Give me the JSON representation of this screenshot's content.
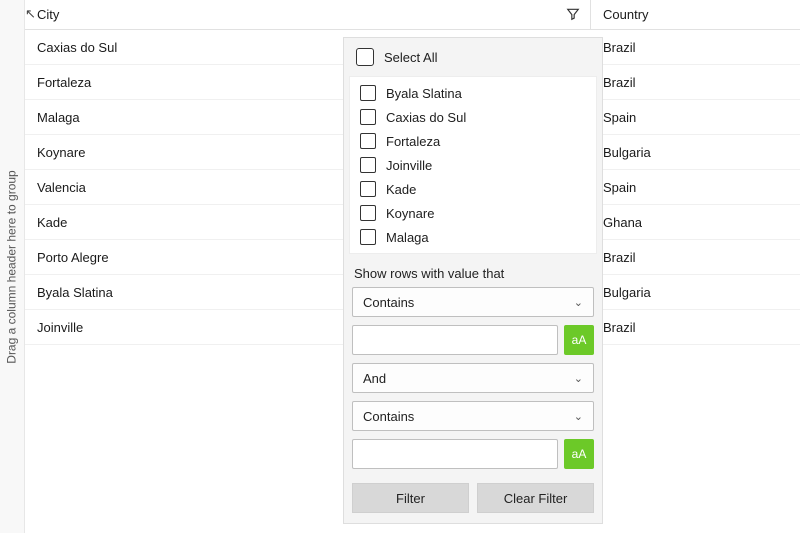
{
  "groupbar_text": "Drag a column header here to group",
  "columns": {
    "city": "City",
    "country": "Country"
  },
  "rows": [
    {
      "city": "Caxias do Sul",
      "country": "Brazil"
    },
    {
      "city": "Fortaleza",
      "country": "Brazil"
    },
    {
      "city": "Malaga",
      "country": "Spain"
    },
    {
      "city": "Koynare",
      "country": "Bulgaria"
    },
    {
      "city": "Valencia",
      "country": "Spain"
    },
    {
      "city": "Kade",
      "country": "Ghana"
    },
    {
      "city": "Porto Alegre",
      "country": "Brazil"
    },
    {
      "city": "Byala Slatina",
      "country": "Bulgaria"
    },
    {
      "city": "Joinville",
      "country": "Brazil"
    }
  ],
  "filter_popup": {
    "select_all_label": "Select All",
    "options": [
      "Byala Slatina",
      "Caxias do Sul",
      "Fortaleza",
      "Joinville",
      "Kade",
      "Koynare",
      "Malaga"
    ],
    "rows_label": "Show rows with value that",
    "condition1": "Contains",
    "logic": "And",
    "condition2": "Contains",
    "case_label": "aA",
    "filter_btn": "Filter",
    "clear_btn": "Clear Filter"
  }
}
